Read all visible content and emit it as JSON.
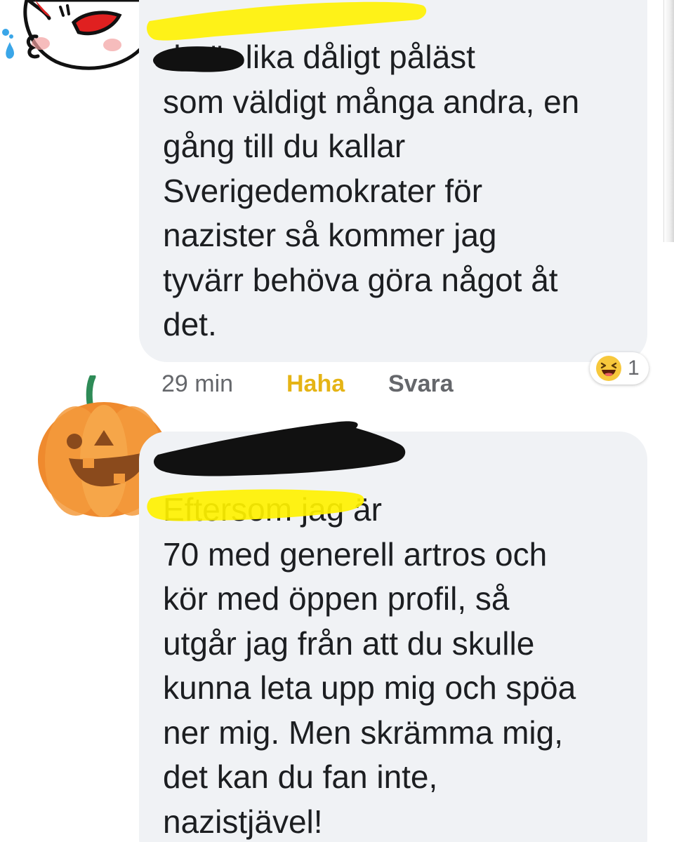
{
  "comments": [
    {
      "text": "du är lika dåligt påläst\nsom väldigt många andra, en\ngång till du kallar\nSverigedemokrater för\nnazister så kommer jag\ntyvärr behöva göra något åt\ndet.",
      "time": "29 min",
      "reaction_label": "Haha",
      "reply_label": "Svara",
      "reaction_count": "1",
      "reaction_icon": "laughing-emoji-icon",
      "avatar_icon": "cartoon-face-avatar"
    },
    {
      "text": "Eftersom jag är\n70 med generell artros och\nkör med öppen profil, så\nutgår jag från att du skulle\nkunna leta upp mig och spöa\nner mig. Men skrämma mig,\ndet kan du fan inte,\nnazistjävel!",
      "avatar_icon": "pumpkin-avatar"
    }
  ],
  "colors": {
    "bubble": "#f0f2f5",
    "text": "#1c1e21",
    "meta": "#65676b",
    "haha": "#e5b416",
    "redaction_yellow": "#fff200",
    "redaction_black": "#111111"
  }
}
